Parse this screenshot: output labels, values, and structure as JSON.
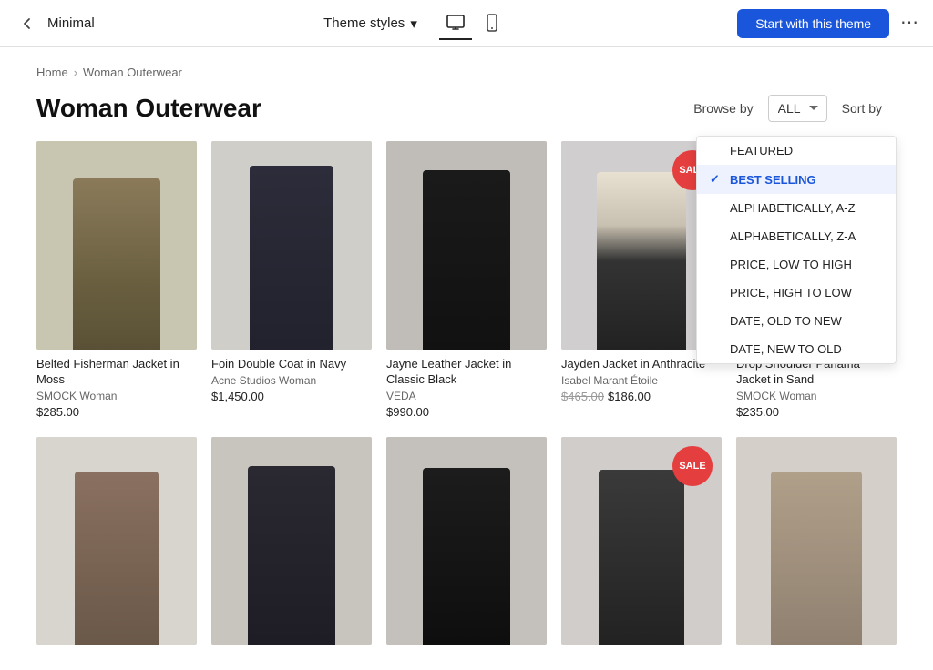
{
  "nav": {
    "back_icon": "←",
    "site_title": "Minimal",
    "theme_styles_label": "Theme styles",
    "chevron_icon": "▾",
    "start_button": "Start with this theme",
    "more_icon": "⋯"
  },
  "breadcrumb": {
    "home": "Home",
    "separator": "›",
    "current": "Woman Outerwear"
  },
  "page": {
    "title": "Woman Outerwear",
    "browse_by_label": "Browse by",
    "sort_by_label": "Sort by",
    "filter_value": "ALL"
  },
  "sort_options": [
    {
      "id": "featured",
      "label": "FEATURED",
      "selected": false
    },
    {
      "id": "best-selling",
      "label": "BEST SELLING",
      "selected": true
    },
    {
      "id": "alpha-asc",
      "label": "ALPHABETICALLY, A-Z",
      "selected": false
    },
    {
      "id": "alpha-desc",
      "label": "ALPHABETICALLY, Z-A",
      "selected": false
    },
    {
      "id": "price-low-high",
      "label": "PRICE, LOW TO HIGH",
      "selected": false
    },
    {
      "id": "price-high-low",
      "label": "PRICE, HIGH TO LOW",
      "selected": false
    },
    {
      "id": "date-old-new",
      "label": "DATE, OLD TO NEW",
      "selected": false
    },
    {
      "id": "date-new-old",
      "label": "DATE, NEW TO OLD",
      "selected": false
    }
  ],
  "products": [
    {
      "id": 1,
      "name": "Belted Fisherman Jacket in Moss",
      "brand": "SMOCK Woman",
      "price": "$285.00",
      "original_price": null,
      "sale": false,
      "img_color": "#7a7a5c"
    },
    {
      "id": 2,
      "name": "Foin Double Coat in Navy",
      "brand": "Acne Studios Woman",
      "price": "$1,450.00",
      "original_price": null,
      "sale": false,
      "img_color": "#2c2c3a"
    },
    {
      "id": 3,
      "name": "Jayne Leather Jacket in Classic Black",
      "brand": "VEDA",
      "price": "$990.00",
      "original_price": null,
      "sale": false,
      "img_color": "#1a1a1a"
    },
    {
      "id": 4,
      "name": "Jayden Jacket in Anthracite",
      "brand": "Isabel Marant Étoile",
      "price": "$186.00",
      "original_price": "$465.00",
      "sale": true,
      "img_color": "#4a4a4a"
    },
    {
      "id": 5,
      "name": "Drop Shoulder Panama Jacket in Sand",
      "brand": "SMOCK Woman",
      "price": "$235.00",
      "original_price": null,
      "sale": false,
      "img_color": "#b5a080"
    }
  ],
  "bottom_row_count": 5,
  "sale_badge_label": "SALE"
}
